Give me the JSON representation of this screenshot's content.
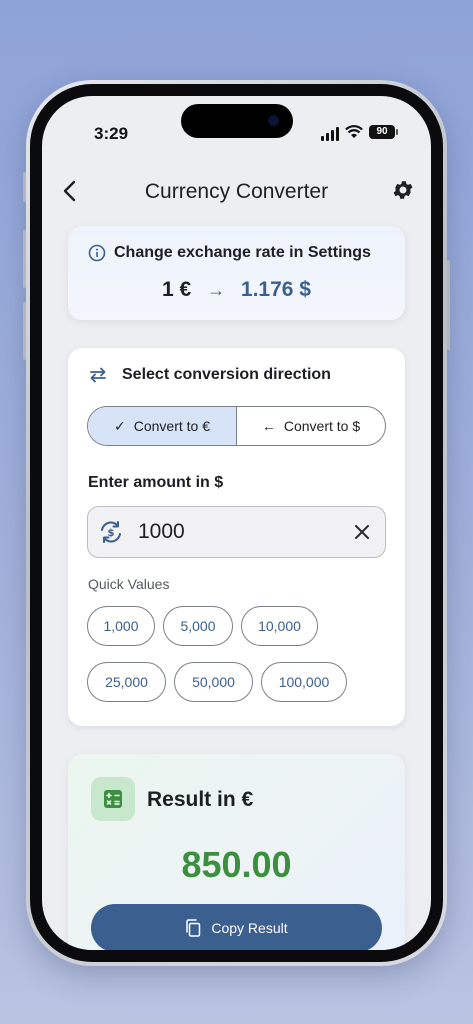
{
  "status_bar": {
    "time": "3:29",
    "battery": "90"
  },
  "nav": {
    "title": "Currency Converter"
  },
  "info": {
    "text": "Change exchange rate in Settings",
    "rate_from": "1 €",
    "rate_to": "1.176 $"
  },
  "converter": {
    "direction_label": "Select conversion direction",
    "segments": [
      {
        "label": "Convert to €",
        "selected": true
      },
      {
        "label": "Convert to $",
        "selected": false
      }
    ],
    "amount_label": "Enter amount in $",
    "amount_value": "1000",
    "quick_label": "Quick Values",
    "quick_values": [
      "1,000",
      "5,000",
      "10,000",
      "25,000",
      "50,000",
      "100,000"
    ]
  },
  "result": {
    "title": "Result in €",
    "value": "850.00",
    "copy_label": "Copy Result"
  },
  "colors": {
    "accent": "#3b5f8f",
    "result_green": "#3b8f3e",
    "selected_segment": "#d7e3f7"
  }
}
